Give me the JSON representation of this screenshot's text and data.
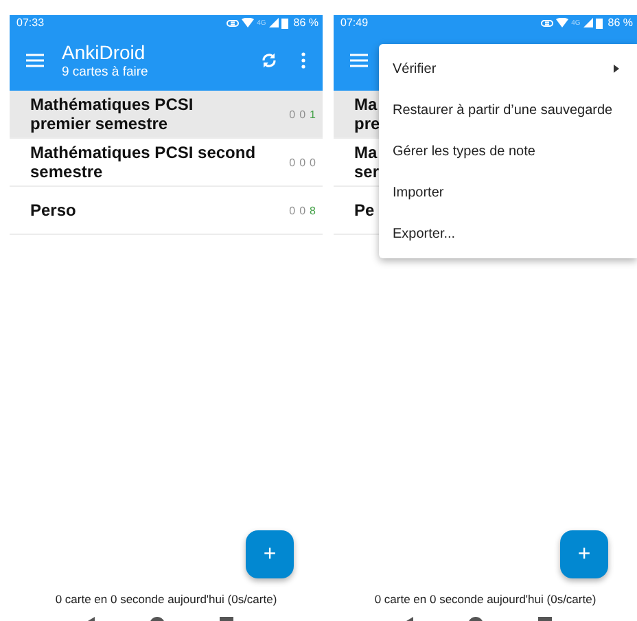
{
  "screens": [
    {
      "status_bar": {
        "time": "07:33",
        "network": "4G",
        "battery": "86 %"
      },
      "toolbar": {
        "title": "AnkiDroid",
        "subtitle": "9 cartes à faire"
      },
      "decks": [
        {
          "name_lines": [
            "Mathématiques PCSI",
            "premier semestre"
          ],
          "selected": true,
          "counts": [
            {
              "value": "0",
              "color": "#8f8f8f"
            },
            {
              "value": "0",
              "color": "#8f8f8f"
            },
            {
              "value": "1",
              "color": "#43a047"
            }
          ]
        },
        {
          "name_lines": [
            "Mathématiques PCSI second",
            "semestre"
          ],
          "selected": false,
          "counts": [
            {
              "value": "0",
              "color": "#8f8f8f"
            },
            {
              "value": "0",
              "color": "#8f8f8f"
            },
            {
              "value": "0",
              "color": "#8f8f8f"
            }
          ]
        },
        {
          "name_lines": [
            "Perso"
          ],
          "selected": false,
          "counts": [
            {
              "value": "0",
              "color": "#8f8f8f"
            },
            {
              "value": "0",
              "color": "#8f8f8f"
            },
            {
              "value": "8",
              "color": "#43a047"
            }
          ]
        }
      ],
      "fab": {
        "label": "+"
      },
      "footer": "0 carte en 0 seconde aujourd'hui (0s/carte)"
    },
    {
      "status_bar": {
        "time": "07:49",
        "network": "4G",
        "battery": "86 %"
      },
      "decks": [
        {
          "name_lines": [
            "Ma",
            "pre"
          ],
          "selected": true
        },
        {
          "name_lines": [
            "Ma",
            "ser"
          ],
          "selected": false
        },
        {
          "name_lines": [
            "Pe"
          ],
          "selected": false
        }
      ],
      "menu": {
        "items": [
          {
            "label": "Vérifier",
            "submenu": true
          },
          {
            "label": "Restaurer à partir d’une sauvegarde",
            "submenu": false
          },
          {
            "label": "Gérer les types de note",
            "submenu": false
          },
          {
            "label": "Importer",
            "submenu": false
          },
          {
            "label": "Exporter...",
            "submenu": false
          }
        ]
      },
      "fab": {
        "label": "+"
      },
      "footer": "0 carte en 0 seconde aujourd'hui (0s/carte)"
    }
  ]
}
